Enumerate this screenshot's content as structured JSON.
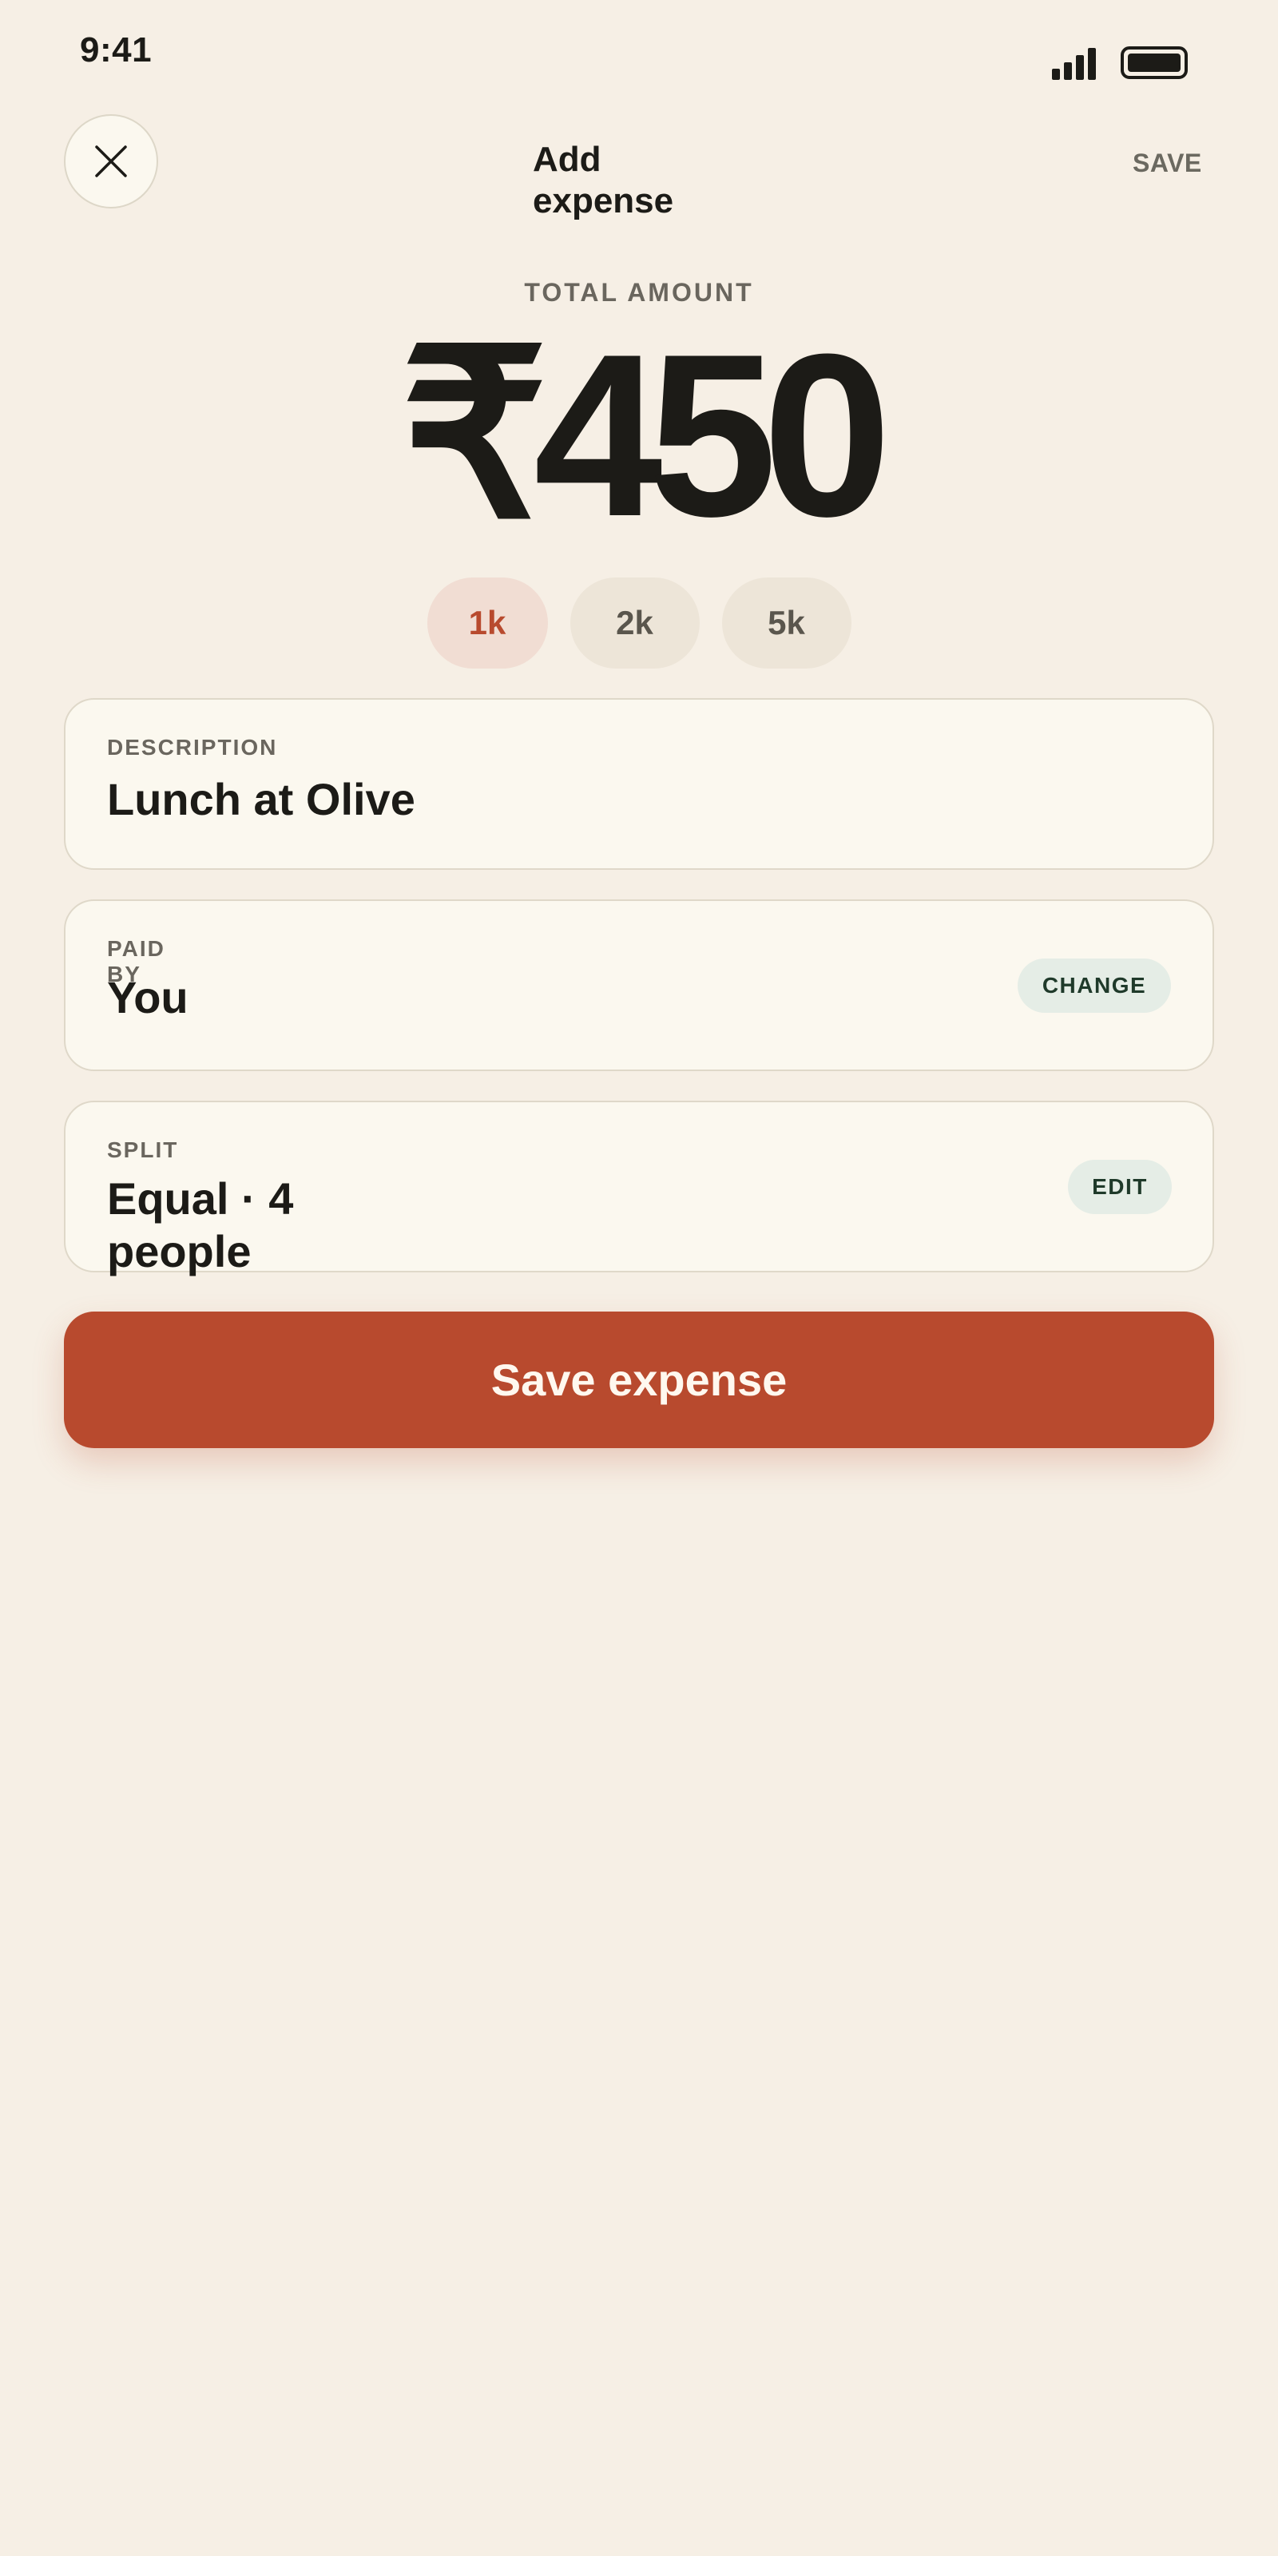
{
  "status_bar": {
    "time": "9:41",
    "signal_icon": "signal-bars-icon",
    "battery_icon": "battery-full-icon"
  },
  "header": {
    "close_icon": "close-icon",
    "title": "Add expense",
    "save_label": "SAVE"
  },
  "amount": {
    "label": "TOTAL AMOUNT",
    "value": "₹450"
  },
  "quick_amounts": [
    {
      "label": "1k",
      "selected": true
    },
    {
      "label": "2k",
      "selected": false
    },
    {
      "label": "5k",
      "selected": false
    }
  ],
  "description": {
    "label": "DESCRIPTION",
    "value": "Lunch at Olive"
  },
  "paid_by": {
    "label": "PAID BY",
    "value": "You",
    "action": "CHANGE"
  },
  "split": {
    "label": "SPLIT",
    "value": "Equal · 4 people",
    "action": "EDIT"
  },
  "primary_action": {
    "label": "Save expense"
  },
  "colors": {
    "background": "#f6efe5",
    "accent": "#b84a2e",
    "card": "#fbf8ef",
    "text": "#1c1b17",
    "pill": "#e5ede6",
    "chip_selected_bg": "#f1ddd3"
  }
}
